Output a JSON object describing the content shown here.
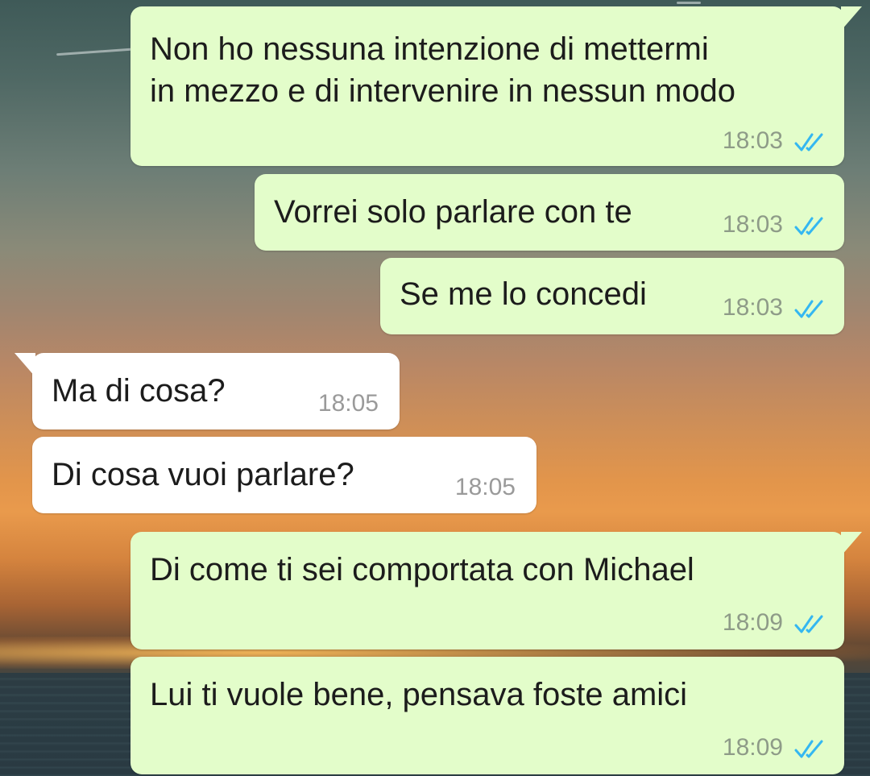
{
  "messages": [
    {
      "direction": "out",
      "lines": [
        "Non ho nessuna intenzione di mettermi",
        "in mezzo e di intervenire in nessun modo"
      ],
      "time": "18:03",
      "status": "read-double-check-icon"
    },
    {
      "direction": "out",
      "lines": [
        "Vorrei solo parlare con te"
      ],
      "time": "18:03",
      "status": "read-double-check-icon"
    },
    {
      "direction": "out",
      "lines": [
        "Se me lo concedi"
      ],
      "time": "18:03",
      "status": "read-double-check-icon"
    },
    {
      "direction": "in",
      "lines": [
        "Ma di cosa?"
      ],
      "time": "18:05"
    },
    {
      "direction": "in",
      "lines": [
        "Di cosa vuoi parlare?"
      ],
      "time": "18:05"
    },
    {
      "direction": "out",
      "lines": [
        "Di come ti sei comportata con Michael"
      ],
      "time": "18:09",
      "status": "read-double-check-icon"
    },
    {
      "direction": "out",
      "lines": [
        "Lui ti vuole bene, pensava foste amici"
      ],
      "time": "18:09",
      "status": "read-double-check-icon"
    }
  ],
  "colors": {
    "outgoing_bubble": "#e3fdca",
    "incoming_bubble": "#ffffff",
    "read_check": "#34b7f1",
    "timestamp": "#8e9b88"
  }
}
